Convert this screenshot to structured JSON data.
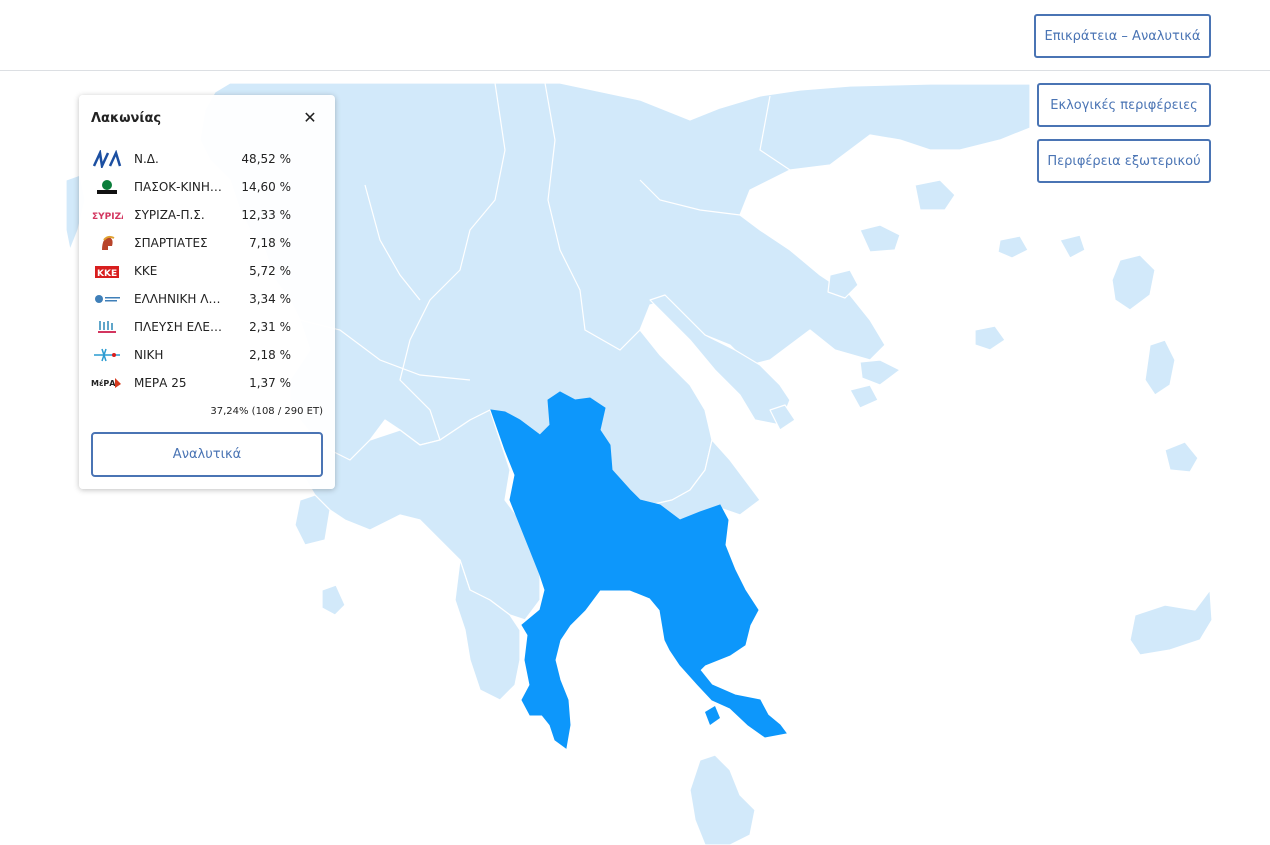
{
  "header": {
    "territory_button": "Επικράτεια – Αναλυτικά"
  },
  "side_buttons": {
    "regions": "Εκλογικές περιφέρειες",
    "abroad": "Περιφέρεια εξωτερικού"
  },
  "map": {
    "land_color": "#d2e9fa",
    "border_color": "#ffffff",
    "selected_color": "#0d97fb",
    "selected_region": "Λακωνίας"
  },
  "panel": {
    "title": "Λακωνίας",
    "close_icon": "close-icon",
    "results": [
      {
        "party": "Ν.Δ.",
        "percent": "48,52 %",
        "icon": "nd-logo-icon",
        "color": "#1c4fa1"
      },
      {
        "party": "ΠΑΣΟΚ-ΚΙΝΗΜΑ ΑΛΛΑΓΗΣ",
        "percent": "14,60 %",
        "icon": "pasok-logo-icon",
        "color": "#0b7d3a"
      },
      {
        "party": "ΣΥΡΙΖΑ-Π.Σ.",
        "percent": "12,33 %",
        "icon": "syriza-logo-icon",
        "color": "#d3355f"
      },
      {
        "party": "ΣΠΑΡΤΙΑΤΕΣ",
        "percent": "7,18 %",
        "icon": "spartiates-logo-icon",
        "color": "#b8442a"
      },
      {
        "party": "ΚΚΕ",
        "percent": "5,72 %",
        "icon": "kke-logo-icon",
        "color": "#d81e1e"
      },
      {
        "party": "ΕΛΛΗΝΙΚΗ ΛΥΣΗ",
        "percent": "3,34 %",
        "icon": "elliniki-lysi-logo-icon",
        "color": "#3f7fb8"
      },
      {
        "party": "ΠΛΕΥΣΗ ΕΛΕΥΘΕΡΙΑΣ",
        "percent": "2,31 %",
        "icon": "plefsi-logo-icon",
        "color": "#2b88b8"
      },
      {
        "party": "ΝΙΚΗ",
        "percent": "2,18 %",
        "icon": "niki-logo-icon",
        "color": "#2a9bd1"
      },
      {
        "party": "ΜΕΡΑ 25",
        "percent": "1,37 %",
        "icon": "mera25-logo-icon",
        "color": "#d63a1f"
      }
    ],
    "counted": "37,24% (108 / 290 ΕΤ)",
    "details_button": "Αναλυτικά"
  }
}
